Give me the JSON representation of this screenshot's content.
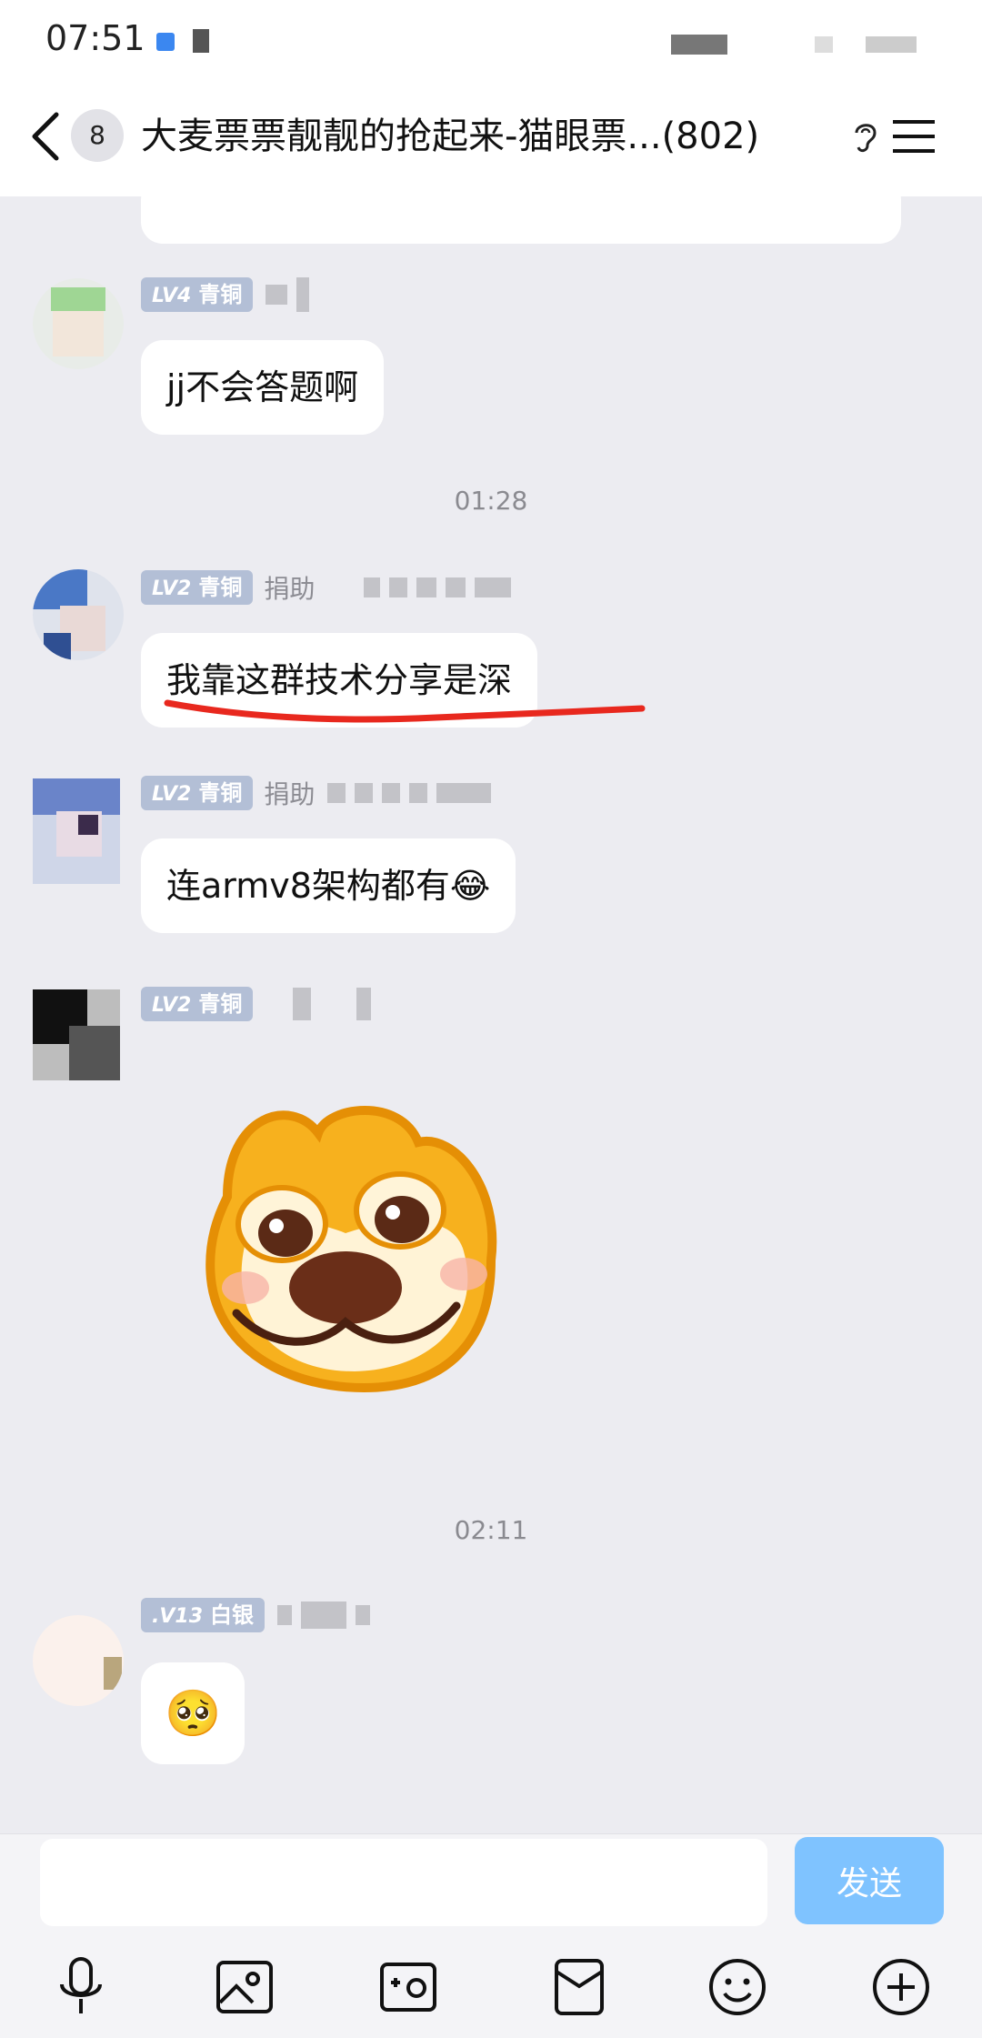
{
  "status_bar": {
    "time": "07:51"
  },
  "header": {
    "unread_count": "8",
    "title": "大麦票票靓靓的抢起来-猫眼票...(802)"
  },
  "messages": {
    "timestamps": [
      "01:28",
      "02:11"
    ],
    "m1": {
      "level": "LV4",
      "rank": "青铜",
      "text": "jj不会答题啊"
    },
    "m2": {
      "level": "LV2",
      "rank": "青铜",
      "donor": "捐助",
      "text": "我靠这群技术分享是深"
    },
    "m3": {
      "level": "LV2",
      "rank": "青铜",
      "donor": "捐助",
      "text": "连armv8架构都有😂"
    },
    "m4": {
      "level": "LV2",
      "rank": "青铜",
      "sticker": "dog-sticker"
    },
    "m5": {
      "level": ".V13",
      "rank": "白银",
      "emoji": "🥺"
    }
  },
  "input": {
    "placeholder": "",
    "send_label": "发送"
  },
  "colors": {
    "accent": "#7fc3ff",
    "badge": "#b3bfd6",
    "underline": "#e8281e"
  }
}
